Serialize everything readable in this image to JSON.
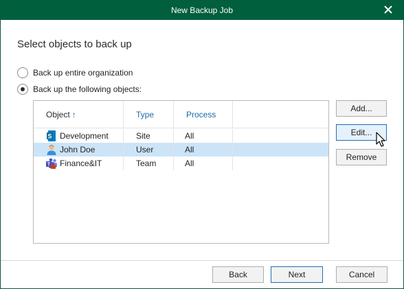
{
  "window": {
    "title": "New Backup Job",
    "close_icon": "close-icon",
    "titlebar_color": "#005f3c"
  },
  "heading": "Select objects to back up",
  "options": [
    {
      "label": "Back up entire organization",
      "selected": false
    },
    {
      "label": "Back up the following objects:",
      "selected": true
    }
  ],
  "table": {
    "columns": [
      {
        "label": "Object",
        "sort_icon": "sort-ascending-arrow-icon"
      },
      {
        "label": "Type"
      },
      {
        "label": "Process"
      }
    ],
    "rows": [
      {
        "icon": "sharepoint-site-icon",
        "object": "Development",
        "type": "Site",
        "process": "All",
        "selected": false
      },
      {
        "icon": "user-icon",
        "object": "John Doe",
        "type": "User",
        "process": "All",
        "selected": true
      },
      {
        "icon": "teams-icon",
        "object": "Finance&IT",
        "type": "Team",
        "process": "All",
        "selected": false
      }
    ],
    "selection_color": "#cce4f7"
  },
  "side_buttons": {
    "add": "Add...",
    "edit": "Edit...",
    "remove": "Remove"
  },
  "footer_buttons": {
    "back": "Back",
    "next": "Next",
    "cancel": "Cancel"
  }
}
